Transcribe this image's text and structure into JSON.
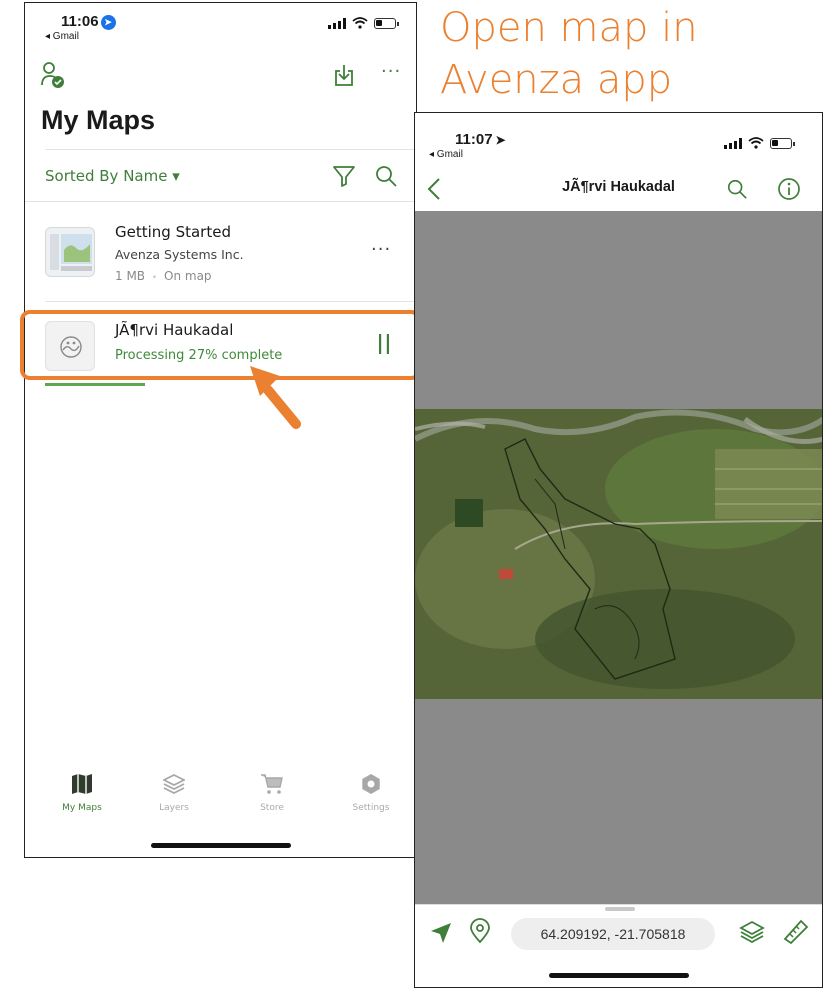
{
  "caption": {
    "line1": "Open map in",
    "line2": "Avenza app"
  },
  "phone1": {
    "status": {
      "time": "11:06",
      "back_app": "◂ Gmail"
    },
    "page_title": "My Maps",
    "sort_label": "Sorted By Name ▾",
    "maps": [
      {
        "title": "Getting Started",
        "publisher": "Avenza Systems Inc.",
        "size": "1 MB",
        "separator": "•",
        "state": "On map"
      },
      {
        "title": "JÃ¶rvi Haukadal",
        "progress_text": "Processing 27% complete",
        "progress": 0.27
      }
    ],
    "tabs": [
      {
        "label": "My Maps",
        "active": true
      },
      {
        "label": "Layers",
        "active": false
      },
      {
        "label": "Store",
        "active": false
      },
      {
        "label": "Settings",
        "active": false
      }
    ]
  },
  "phone2": {
    "status": {
      "time": "11:07",
      "back_app": "◂ Gmail"
    },
    "map_title": "JÃ¶rvi Haukadal",
    "coordinates": "64.209192, -21.705818"
  },
  "colors": {
    "accent": "#3f7f3a",
    "callout": "#ea8030",
    "map_gray": "#8a8a8a"
  },
  "icons": [
    "user-check-icon",
    "download-icon",
    "more-icon",
    "filter-icon",
    "search-icon",
    "pause-icon",
    "map-tab-icon",
    "layers-tab-icon",
    "cart-tab-icon",
    "gear-tab-icon",
    "back-chevron-icon",
    "info-icon",
    "location-arrow-icon",
    "pin-icon",
    "measure-ruler-icon"
  ]
}
